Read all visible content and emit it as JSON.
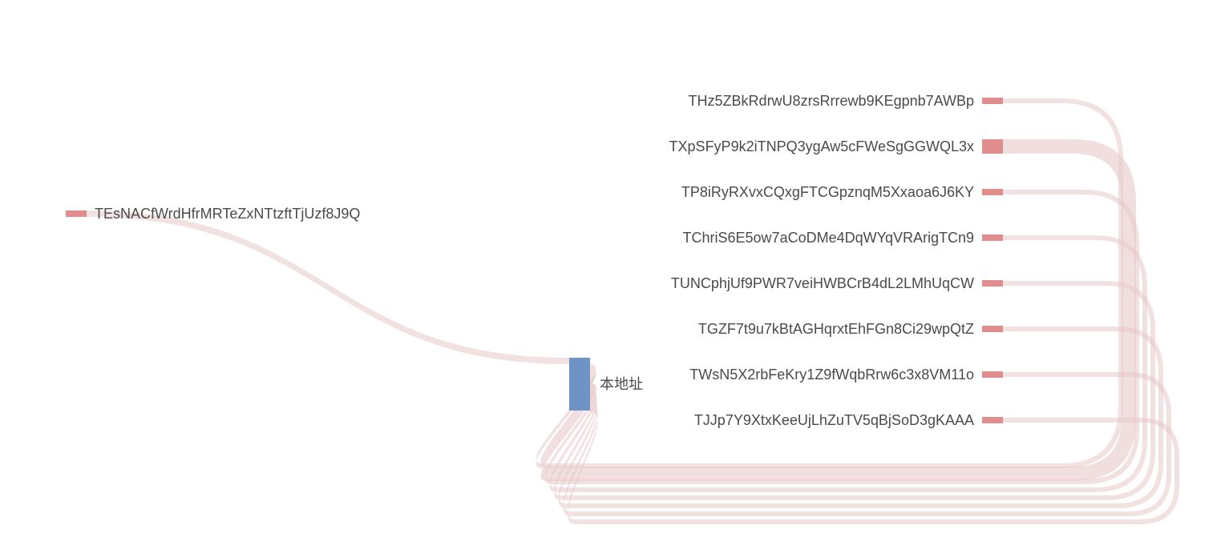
{
  "chart_data": {
    "type": "sankey",
    "colors": {
      "source_node": "#e28d8d",
      "center_node": "#6f93c4",
      "target_node": "#e28d8d",
      "flow": "#e7c9c9"
    },
    "source": {
      "id": "src",
      "label": "TEsNACfWrdHfrMRTeZxNTtzftTjUzf8J9Q",
      "weight": 1
    },
    "center": {
      "id": "hub",
      "label": "本地址",
      "weight": 11
    },
    "targets": [
      {
        "id": "t1",
        "label": "THz5ZBkRdrwU8zrsRrrewb9KEgpnb7AWBp",
        "weight": 1
      },
      {
        "id": "t2",
        "label": "TXpSFyP9k2iTNPQ3ygAw5cFWeSgGGWQL3x",
        "weight": 3
      },
      {
        "id": "t3",
        "label": "TP8iRyRXvxCQxgFTCGpznqM5Xxaoa6J6KY",
        "weight": 1
      },
      {
        "id": "t4",
        "label": "TChriS6E5ow7aCoDMe4DqWYqVRArigTCn9",
        "weight": 1
      },
      {
        "id": "t5",
        "label": "TUNCphjUf9PWR7veiHWBCrB4dL2LMhUqCW",
        "weight": 1
      },
      {
        "id": "t6",
        "label": "TGZF7t9u7kBtAGHqrxtEhFGn8Ci29wpQtZ",
        "weight": 1
      },
      {
        "id": "t7",
        "label": "TWsN5X2rbFeKry1Z9fWqbRrw6c3x8VM11o",
        "weight": 1
      },
      {
        "id": "t8",
        "label": "TJJp7Y9XtxKeeUjLhZuTV5qBjSoD3gKAAA",
        "weight": 1
      }
    ],
    "links": [
      {
        "from": "src",
        "to": "hub",
        "weight": 1
      },
      {
        "from": "hub",
        "to": "t1",
        "weight": 1
      },
      {
        "from": "hub",
        "to": "t2",
        "weight": 3
      },
      {
        "from": "hub",
        "to": "t3",
        "weight": 1
      },
      {
        "from": "hub",
        "to": "t4",
        "weight": 1
      },
      {
        "from": "hub",
        "to": "t5",
        "weight": 1
      },
      {
        "from": "hub",
        "to": "t6",
        "weight": 1
      },
      {
        "from": "hub",
        "to": "t7",
        "weight": 1
      },
      {
        "from": "hub",
        "to": "t8",
        "weight": 1
      }
    ]
  }
}
